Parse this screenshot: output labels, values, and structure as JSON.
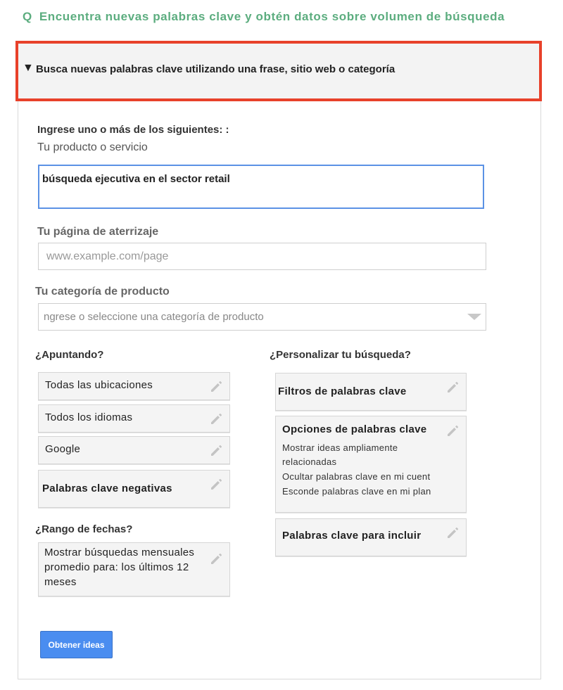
{
  "heading": {
    "prefix": "Q",
    "text": "Encuentra nuevas palabras clave y obtén datos sobre volumen de búsqueda"
  },
  "section": {
    "arrow": "▼",
    "title": "Busca nuevas palabras clave utilizando una frase, sitio web o categoría"
  },
  "form": {
    "intro_label": "Ingrese uno o más de los siguientes: :",
    "product_label": "Tu producto o servicio",
    "product_value": "búsqueda ejecutiva en el sector retail",
    "landing_label": "Tu página de aterrizaje",
    "landing_placeholder": "www.example.com/page",
    "category_label": "Tu categoría de producto",
    "category_placeholder": "ngrese o seleccione una categoría de producto"
  },
  "targeting": {
    "label": "¿Apuntando?",
    "locations": "Todas las ubicaciones",
    "languages": "Todos los idiomas",
    "network": "Google",
    "negative_keywords": "Palabras clave negativas"
  },
  "date_range": {
    "label": "¿Rango de fechas?",
    "value": "Mostrar búsquedas mensuales promedio para: los últimos 12 meses"
  },
  "customize": {
    "label": "¿Personalizar tu búsqueda?",
    "filters": "Filtros de palabras clave",
    "options_title": "Opciones de palabras clave",
    "option_1a": "Mostrar ideas ampliamente",
    "option_1b": "relacionadas",
    "option_2": "Ocultar palabras clave en mi cuent",
    "option_3": "Esconde palabras clave en mi plan",
    "include": "Palabras clave para incluir"
  },
  "actions": {
    "get_ideas": "Obtener ideas"
  },
  "icons": {
    "edit": "pencil-icon",
    "collapse": "triangle-down-icon",
    "dropdown": "chevron-down-icon"
  },
  "colors": {
    "heading": "#5cad7f",
    "highlight_border": "#e8412a",
    "button": "#4a8df0",
    "active_input": "#5b92e5"
  }
}
